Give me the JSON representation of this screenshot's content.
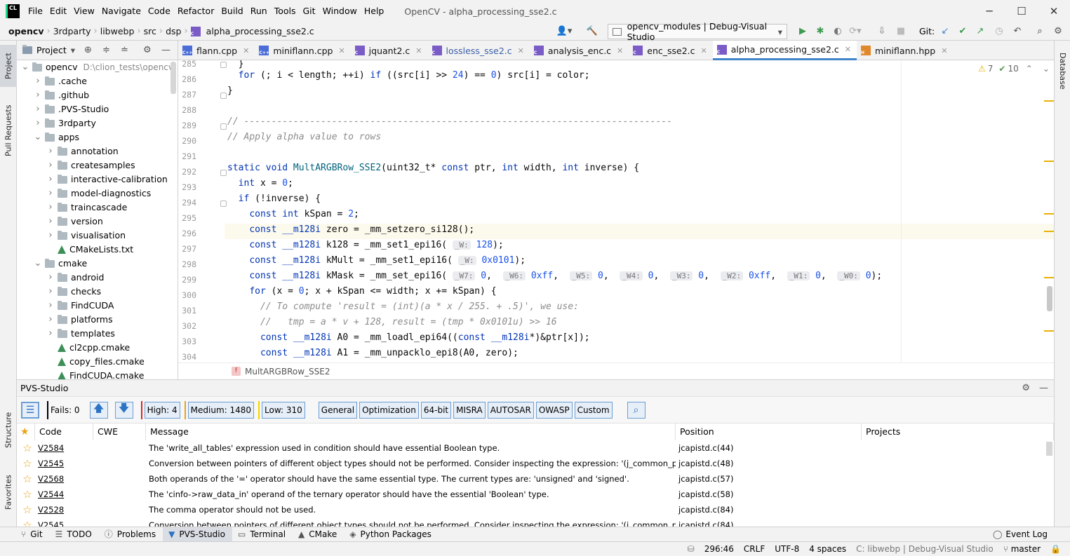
{
  "menu": {
    "items": [
      "File",
      "Edit",
      "View",
      "Navigate",
      "Code",
      "Refactor",
      "Build",
      "Run",
      "Tools",
      "Git",
      "Window",
      "Help"
    ],
    "window_title": "OpenCV - alpha_processing_sse2.c"
  },
  "breadcrumbs": [
    "opencv",
    "3rdparty",
    "libwebp",
    "src",
    "dsp",
    "alpha_processing_sse2.c"
  ],
  "run_config": "opencv_modules | Debug-Visual Studio",
  "git_label": "Git:",
  "left_strip": {
    "project": "Project",
    "pull_requests": "Pull Requests",
    "structure": "Structure",
    "favorites": "Favorites"
  },
  "right_strip": {
    "database": "Database"
  },
  "project_panel": {
    "title": "Project",
    "tree": [
      {
        "label": "opencv",
        "extra": "D:\\clion_tests\\opencv",
        "depth": 0,
        "type": "folder",
        "expanded": true
      },
      {
        "label": ".cache",
        "depth": 1,
        "type": "folder"
      },
      {
        "label": ".github",
        "depth": 1,
        "type": "folder"
      },
      {
        "label": ".PVS-Studio",
        "depth": 1,
        "type": "folder"
      },
      {
        "label": "3rdparty",
        "depth": 1,
        "type": "folder"
      },
      {
        "label": "apps",
        "depth": 1,
        "type": "folder",
        "expanded": true
      },
      {
        "label": "annotation",
        "depth": 2,
        "type": "folder"
      },
      {
        "label": "createsamples",
        "depth": 2,
        "type": "folder"
      },
      {
        "label": "interactive-calibration",
        "depth": 2,
        "type": "folder"
      },
      {
        "label": "model-diagnostics",
        "depth": 2,
        "type": "folder"
      },
      {
        "label": "traincascade",
        "depth": 2,
        "type": "folder"
      },
      {
        "label": "version",
        "depth": 2,
        "type": "folder"
      },
      {
        "label": "visualisation",
        "depth": 2,
        "type": "folder"
      },
      {
        "label": "CMakeLists.txt",
        "depth": 2,
        "type": "cmake"
      },
      {
        "label": "cmake",
        "depth": 1,
        "type": "folder",
        "expanded": true
      },
      {
        "label": "android",
        "depth": 2,
        "type": "folder"
      },
      {
        "label": "checks",
        "depth": 2,
        "type": "folder"
      },
      {
        "label": "FindCUDA",
        "depth": 2,
        "type": "folder"
      },
      {
        "label": "platforms",
        "depth": 2,
        "type": "folder"
      },
      {
        "label": "templates",
        "depth": 2,
        "type": "folder"
      },
      {
        "label": "cl2cpp.cmake",
        "depth": 2,
        "type": "cmake"
      },
      {
        "label": "copy_files.cmake",
        "depth": 2,
        "type": "cmake"
      },
      {
        "label": "FindCUDA.cmake",
        "depth": 2,
        "type": "cmake"
      }
    ]
  },
  "tabs": [
    {
      "label": "flann.cpp",
      "kind": "cpp",
      "color": "#4a6dd8"
    },
    {
      "label": "miniflann.cpp",
      "kind": "cpp",
      "color": "#4a6dd8"
    },
    {
      "label": "jquant2.c",
      "kind": "c",
      "color": "#7b5cc7"
    },
    {
      "label": "lossless_sse2.c",
      "kind": "c",
      "color": "#7b5cc7"
    },
    {
      "label": "analysis_enc.c",
      "kind": "c",
      "color": "#7b5cc7"
    },
    {
      "label": "enc_sse2.c",
      "kind": "c",
      "color": "#7b5cc7"
    },
    {
      "label": "alpha_processing_sse2.c",
      "kind": "c",
      "color": "#7b5cc7",
      "active": true
    },
    {
      "label": "miniflann.hpp",
      "kind": "h",
      "color": "#e0882c"
    }
  ],
  "inspections": {
    "warnings": "7",
    "weak": "10"
  },
  "code": {
    "lines": [
      "285",
      "286",
      "287",
      "288",
      "289",
      "290",
      "291",
      "292",
      "293",
      "294",
      "295",
      "296",
      "297",
      "298",
      "299",
      "300",
      "301",
      "302",
      "303",
      "304"
    ]
  },
  "editor_breadcrumb": "MultARGBRow_SSE2",
  "pvs": {
    "title": "PVS-Studio",
    "fails": "Fails: 0",
    "high": "High: 4",
    "medium": "Medium: 1480",
    "low": "Low: 310",
    "filters": [
      "General",
      "Optimization",
      "64-bit",
      "MISRA",
      "AUTOSAR",
      "OWASP",
      "Custom"
    ],
    "columns": {
      "code": "Code",
      "cwe": "CWE",
      "message": "Message",
      "position": "Position",
      "projects": "Projects"
    },
    "rows": [
      {
        "code": "V2584",
        "message": "The 'write_all_tables' expression used in condition should have essential Boolean type.",
        "position": "jcapistd.c(44)"
      },
      {
        "code": "V2545",
        "message": "Conversion between pointers of different object types should not be performed. Consider inspecting the expression: '(j_common_ptr) cinfo'.",
        "position": "jcapistd.c(48)"
      },
      {
        "code": "V2568",
        "message": "Both operands of the '=' operator should have the same essential type. The current types are: 'unsigned' and 'signed'.",
        "position": "jcapistd.c(57)"
      },
      {
        "code": "V2544",
        "message": "The 'cinfo->raw_data_in' operand of the ternary operator should have the essential 'Boolean' type.",
        "position": "jcapistd.c(58)"
      },
      {
        "code": "V2528",
        "message": "The comma operator should not be used.",
        "position": "jcapistd.c(84)"
      },
      {
        "code": "V2545",
        "message": "Conversion between pointers of different object types should not be performed. Consider inspecting the expression: '(j_common_ptr) cinfo'.",
        "position": "jcapistd.c(84)"
      }
    ]
  },
  "bottom_tabs": [
    "Git",
    "TODO",
    "Problems",
    "PVS-Studio",
    "Terminal",
    "CMake",
    "Python Packages"
  ],
  "event_log": "Event Log",
  "status": {
    "position": "296:46",
    "line_sep": "CRLF",
    "encoding": "UTF-8",
    "indent": "4 spaces",
    "context": "C: libwebp | Debug-Visual Studio",
    "branch": "master"
  }
}
